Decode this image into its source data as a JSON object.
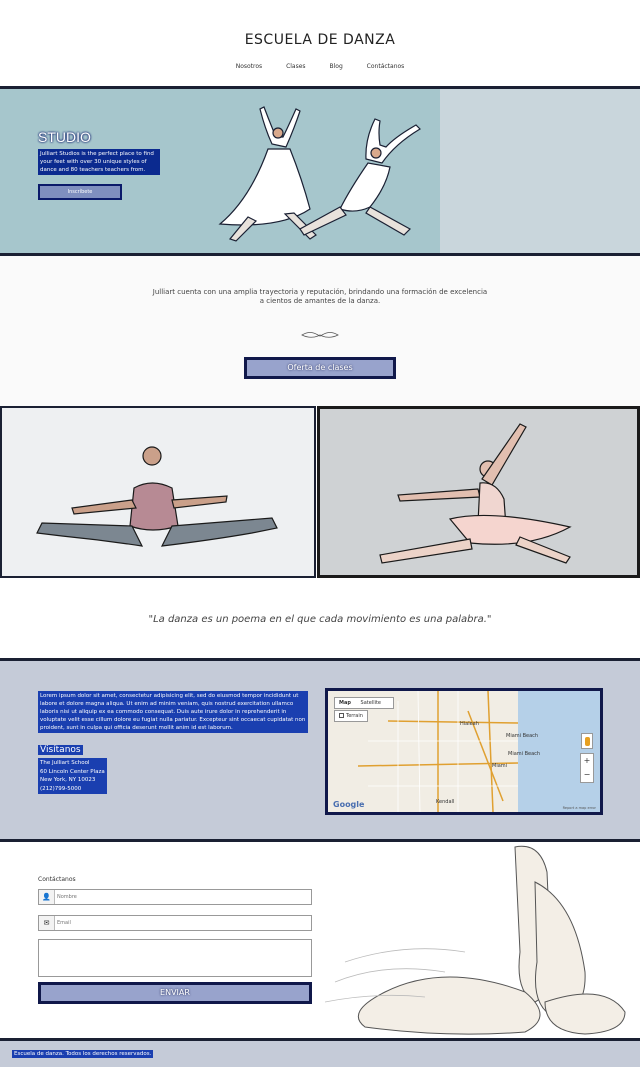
{
  "header": {
    "site_title": "ESCUELA DE DANZA",
    "nav": [
      "Nosotros",
      "Clases",
      "Blog",
      "Contáctanos"
    ]
  },
  "hero": {
    "title": "STUDIO",
    "text": "Julliart Studios is the perfect place to find your feet with over 30 unique styles of dance and 80 teachers teachers from.",
    "button": "Inscríbete"
  },
  "intro": {
    "text": "Julliart cuenta con una amplia trayectoria y reputación, brindando una formación de excelencia a cientos de amantes de la danza.",
    "button": "Oferta de clases"
  },
  "quote": "\"La danza es un poema en el que cada movimiento es una palabra.\"",
  "info": {
    "lorem": "Lorem ipsum dolor sit amet, consectetur adipisicing elit, sed do eiusmod tempor incididunt ut labore et dolore magna aliqua. Ut enim ad minim veniam, quis nostrud exercitation ullamco laboris nisi ut aliquip ex ea commodo consequat. Duis aute irure dolor in reprehenderit in voluptate velit esse cillum dolore eu fugiat nulla pariatur. Excepteur sint occaecat cupidatat non proident, sunt in culpa qui officia deserunt mollit anim id est laborum.",
    "visit_title": "Visítanos",
    "address": [
      "The Julliart School",
      "60 Lincoln Center Plaza",
      "New York, NY 10023",
      "(212)799-5000"
    ]
  },
  "map": {
    "tabs": [
      "Map",
      "Satellite"
    ],
    "checkbox": "Terrain",
    "labels": [
      "Miami Beach",
      "Hialeah",
      "Miami",
      "Miami Beach",
      "Kendall"
    ],
    "google": "Google",
    "credit": "Report a map error"
  },
  "contact": {
    "label": "Contáctanos",
    "name_placeholder": "Nombre",
    "email_placeholder": "Email",
    "button": "ENVIAR"
  },
  "footer": {
    "text": "Escuela de danza. Todos los derechos reservados."
  }
}
